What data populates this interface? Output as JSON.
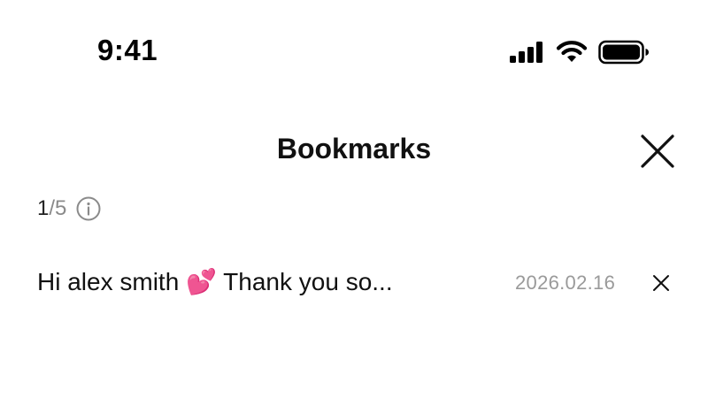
{
  "status_bar": {
    "time": "9:41",
    "icons": [
      "cellular-signal-icon",
      "wifi-icon",
      "battery-icon"
    ]
  },
  "header": {
    "title": "Bookmarks",
    "close_icon": "close-icon"
  },
  "counter": {
    "current": "1",
    "total": "/5",
    "info_icon": "info-icon"
  },
  "bookmarks": [
    {
      "text": "Hi alex smith 💕 Thank you so...",
      "date": "2026.02.16",
      "remove_icon": "close-icon"
    }
  ],
  "colors": {
    "text_primary": "#111111",
    "text_secondary": "#9a9a9a",
    "background": "#ffffff"
  }
}
